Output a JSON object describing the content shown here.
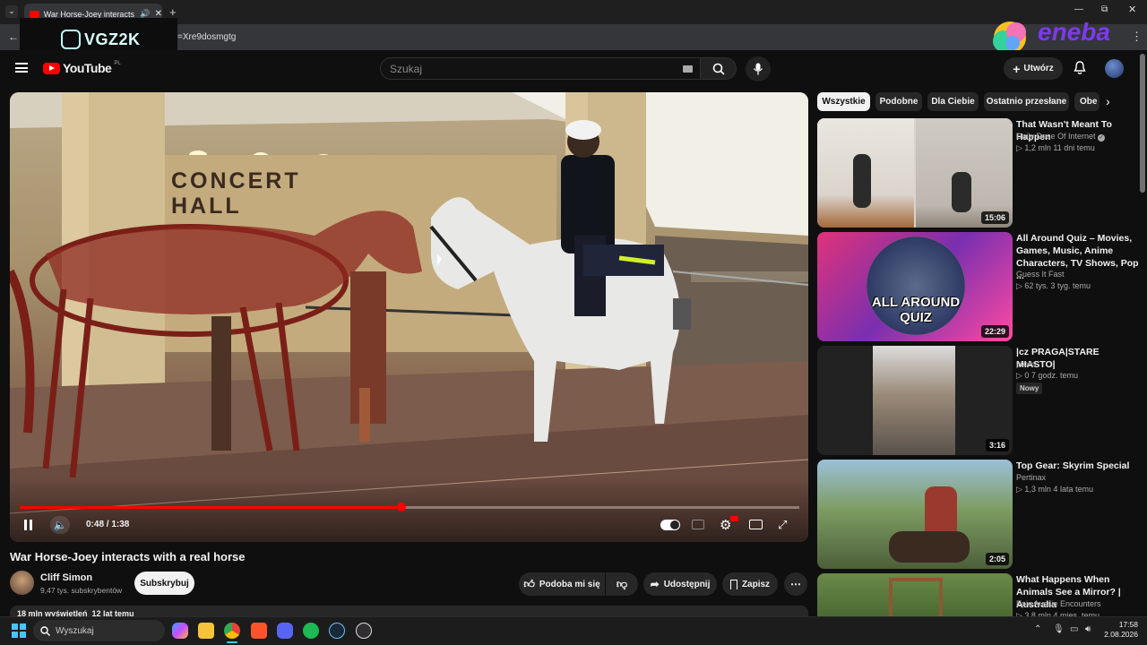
{
  "browser": {
    "tab_title": "War Horse-Joey interacts wi",
    "url_fragment": "=Xre9dosmgtg",
    "window_controls": [
      "minimize",
      "maximize",
      "close"
    ]
  },
  "overlay": {
    "streamer_logo": "VGZ2K",
    "sponsor_logo": "eneba"
  },
  "header": {
    "logo": "YouTube",
    "logo_region": "PL",
    "search_placeholder": "Szukaj",
    "create_label": "Utwórz"
  },
  "player": {
    "time_current": "0:48",
    "time_total": "1:38",
    "time_display": "0:48 / 1:38",
    "progress": 0.4898,
    "sign_line1": "CONCERT",
    "sign_line2": "HALL"
  },
  "video": {
    "title": "War Horse-Joey interacts with a real horse",
    "channel": "Cliff Simon",
    "subscribers": "9,47 tys. subskrybentów",
    "subscribe_label": "Subskrybuj",
    "like_label": "Podoba mi się",
    "share_label": "Udostępnij",
    "save_label": "Zapisz",
    "desc_meta": "18 mln wyświetleń  12 lat temu"
  },
  "chips": [
    "Wszystkie",
    "Podobne",
    "Dla Ciebie",
    "Ostatnio przesłane",
    "Obe"
  ],
  "recommendations": [
    {
      "title": "That Wasn't Meant To Happen",
      "channel": "Daily Dose Of Internet",
      "verified": true,
      "meta": "▷ 1,2 mln  11 dni temu",
      "duration": "15:06"
    },
    {
      "title": "All Around Quiz – Movies, Games, Music, Anime Characters, TV Shows, Pop ...",
      "channel": "Guess It Fast",
      "meta": "▷ 62 tys.  3 tyg. temu",
      "duration": "22:29",
      "thumb_text_1": "ALL AROUND",
      "thumb_text_2": "QUIZ"
    },
    {
      "title": "|cz PRAGA|STARE MIASTO|",
      "channel": "proes",
      "meta": "▷ 0  7 godz. temu",
      "badge": "Nowy",
      "duration": "3:16"
    },
    {
      "title": "Top Gear: Skyrim Special",
      "channel": "Pertinax",
      "meta": "▷ 1,3 mln  4 lata temu",
      "duration": "2:05"
    },
    {
      "title": "What Happens When Animals See a Mirror? | Australia",
      "channel": "Epic Aussie Encounters",
      "meta": "▷ 3,8 mln  4 mies. temu",
      "duration": ""
    }
  ],
  "taskbar": {
    "search_label": "Wyszukaj",
    "time": "17:58",
    "date": "2.08.2026"
  }
}
